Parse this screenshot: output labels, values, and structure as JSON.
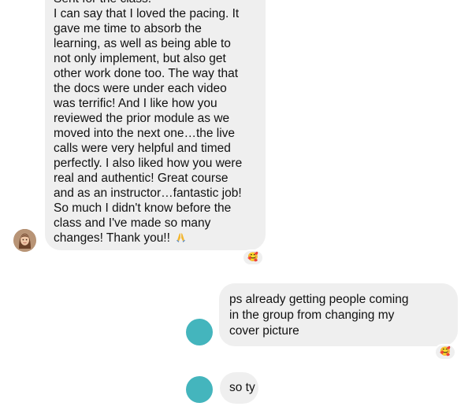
{
  "conversation": {
    "incoming_message": {
      "cut_top_line": "Sent for the class.",
      "lines": [
        "I can say that I loved the pacing. It",
        "gave me time to absorb the",
        "learning, as well as being able to",
        "not only implement, but also get",
        "other work done too. The way that",
        "the docs were under each video",
        "was terrific! And I like how you",
        "reviewed the prior module as we",
        "moved into the next one…the live",
        "calls were very helpful and timed",
        "perfectly. I also liked how you were",
        "real and authentic! Great course",
        "and as an instructor…fantastic job!",
        "So much I didn't know before the",
        "class and I've made so many",
        "changes! Thank you!!"
      ],
      "reaction": "🥰"
    },
    "outgoing_message": {
      "lines": [
        "ps already getting people coming",
        "in the group from changing my",
        "cover picture"
      ],
      "reaction": "🥰"
    },
    "outgoing_short_message": {
      "text": "so ty"
    }
  },
  "icons": {
    "pray": "folded-hands-icon",
    "reaction": "smiling-face-with-hearts-icon"
  },
  "colors": {
    "bubble": "#efefef",
    "avatar_accent": "#44b5bd"
  }
}
